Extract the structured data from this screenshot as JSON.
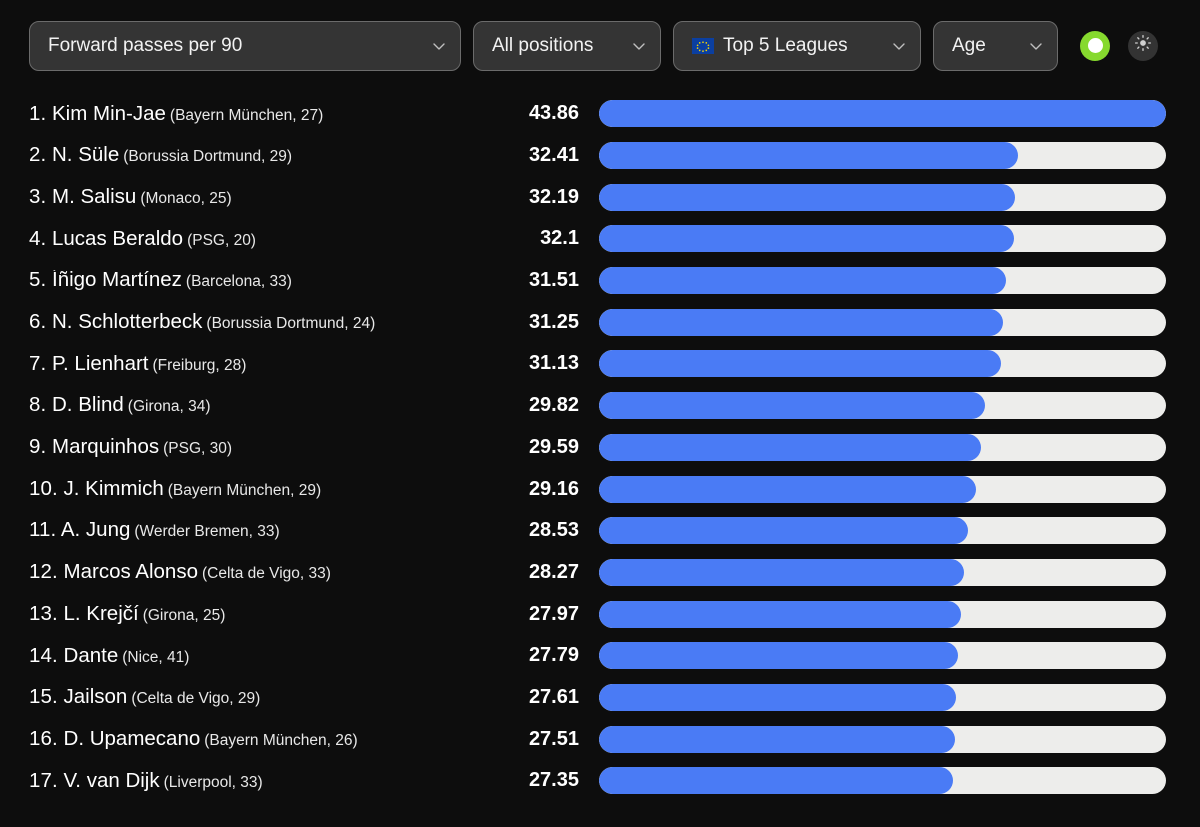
{
  "toolbar": {
    "metric": {
      "value": "Forward passes per 90",
      "icon": "chevron-down-icon"
    },
    "position": {
      "value": "All positions",
      "icon": "chevron-down-icon"
    },
    "league": {
      "value": "Top 5 Leagues",
      "flag": "european-union-flag-icon",
      "icon": "chevron-down-icon"
    },
    "age": {
      "value": "Age",
      "icon": "chevron-down-icon"
    },
    "toggle": {
      "name": "green-toggle",
      "state": "on",
      "color": "#86d92e"
    },
    "theme_button": {
      "name": "brightness-sun-icon"
    }
  },
  "colors": {
    "background": "#0d0d0d",
    "bar_fill": "#4a7bf5",
    "bar_track": "#ededeb",
    "control_bg": "#343434",
    "control_border": "#6b6b6b",
    "toggle_green": "#86d92e",
    "text": "#ffffff"
  },
  "chart_data": {
    "type": "bar",
    "title": "Forward passes per 90",
    "orientation": "horizontal",
    "xlabel": "",
    "ylabel": "",
    "grid": false,
    "legend": null,
    "max_value": 43.86,
    "xlim": [
      0,
      43.86
    ],
    "categories": [
      "Kim Min-Jae",
      "N. Süle",
      "M. Salisu",
      "Lucas Beraldo",
      "Íñigo Martínez",
      "N. Schlotterbeck",
      "P. Lienhart",
      "D. Blind",
      "Marquinhos",
      "J. Kimmich",
      "A. Jung",
      "Marcos Alonso",
      "L. Krejčí",
      "Dante",
      "Jailson",
      "D. Upamecano",
      "V. van Dijk"
    ],
    "values": [
      43.86,
      32.41,
      32.19,
      32.1,
      31.51,
      31.25,
      31.13,
      29.82,
      29.59,
      29.16,
      28.53,
      28.27,
      27.97,
      27.79,
      27.61,
      27.51,
      27.35
    ]
  },
  "rows": [
    {
      "rank": "1.",
      "name": "Kim Min-Jae",
      "meta": "(Bayern München, 27)",
      "value": "43.86",
      "pct": 100.0
    },
    {
      "rank": "2.",
      "name": "N. Süle",
      "meta": "(Borussia Dortmund, 29)",
      "value": "32.41",
      "pct": 73.89
    },
    {
      "rank": "3.",
      "name": "M. Salisu",
      "meta": "(Monaco, 25)",
      "value": "32.19",
      "pct": 73.39
    },
    {
      "rank": "4.",
      "name": "Lucas Beraldo",
      "meta": "(PSG, 20)",
      "value": "32.1",
      "pct": 73.19
    },
    {
      "rank": "5.",
      "name": "Íñigo Martínez",
      "meta": "(Barcelona, 33)",
      "value": "31.51",
      "pct": 71.84
    },
    {
      "rank": "6.",
      "name": "N. Schlotterbeck",
      "meta": "(Borussia Dortmund, 24)",
      "value": "31.25",
      "pct": 71.25
    },
    {
      "rank": "7.",
      "name": "P. Lienhart",
      "meta": "(Freiburg, 28)",
      "value": "31.13",
      "pct": 70.97
    },
    {
      "rank": "8.",
      "name": "D. Blind",
      "meta": "(Girona, 34)",
      "value": "29.82",
      "pct": 67.99
    },
    {
      "rank": "9.",
      "name": "Marquinhos",
      "meta": "(PSG, 30)",
      "value": "29.59",
      "pct": 67.46
    },
    {
      "rank": "10.",
      "name": "J. Kimmich",
      "meta": "(Bayern München, 29)",
      "value": "29.16",
      "pct": 66.48
    },
    {
      "rank": "11.",
      "name": "A. Jung",
      "meta": "(Werder Bremen, 33)",
      "value": "28.53",
      "pct": 65.05
    },
    {
      "rank": "12.",
      "name": "Marcos Alonso",
      "meta": "(Celta de Vigo, 33)",
      "value": "28.27",
      "pct": 64.45
    },
    {
      "rank": "13.",
      "name": "L. Krejčí",
      "meta": "(Girona, 25)",
      "value": "27.97",
      "pct": 63.77
    },
    {
      "rank": "14.",
      "name": "Dante",
      "meta": "(Nice, 41)",
      "value": "27.79",
      "pct": 63.36
    },
    {
      "rank": "15.",
      "name": "Jailson",
      "meta": "(Celta de Vigo, 29)",
      "value": "27.61",
      "pct": 62.95
    },
    {
      "rank": "16.",
      "name": "D. Upamecano",
      "meta": "(Bayern München, 26)",
      "value": "27.51",
      "pct": 62.72
    },
    {
      "rank": "17.",
      "name": "V. van Dijk",
      "meta": "(Liverpool, 33)",
      "value": "27.35",
      "pct": 62.36
    }
  ]
}
